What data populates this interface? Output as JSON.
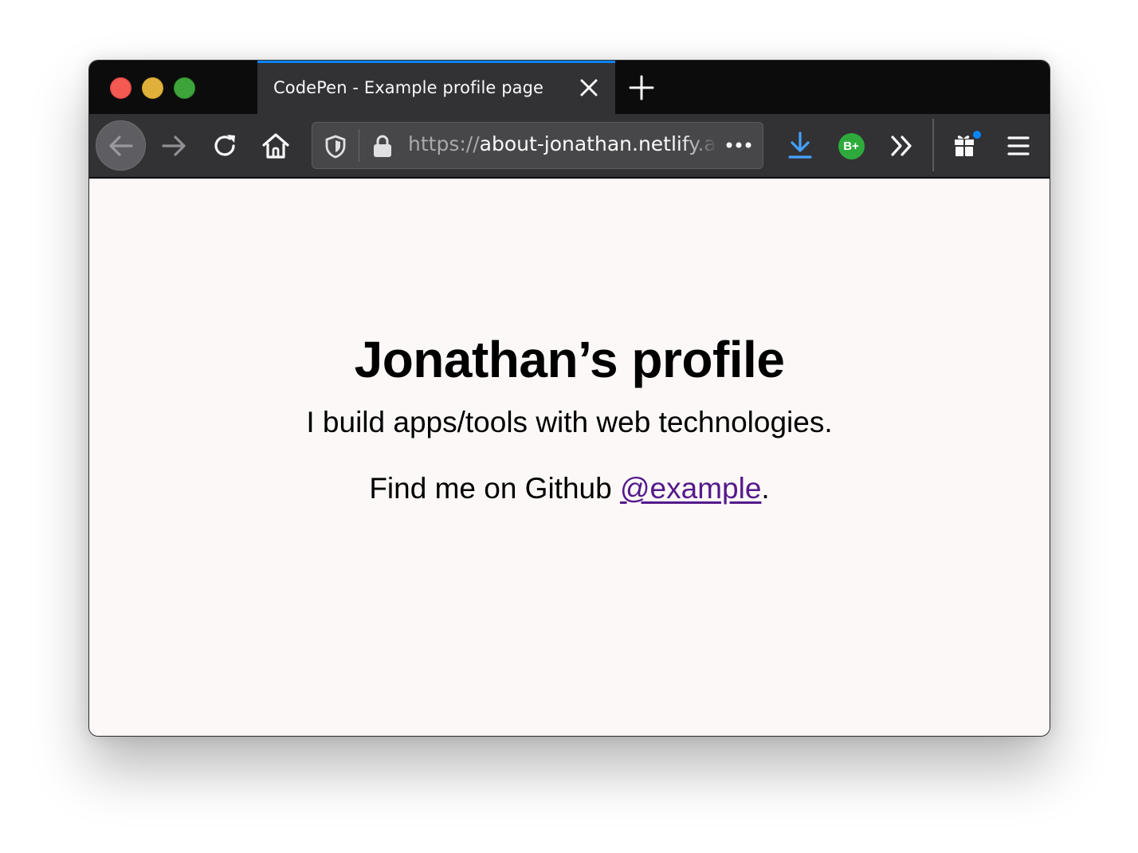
{
  "browser": {
    "tab": {
      "title": "CodePen - Example profile page"
    },
    "urlbar": {
      "scheme": "https://",
      "host": "about-jonathan.netlify.app"
    },
    "extensions": {
      "bplus_label": "B+"
    },
    "colors": {
      "accent": "#0a84ff",
      "tab_strip": "#0c0c0d",
      "toolbar": "#323234",
      "download_icon": "#45a1ff",
      "extension_badge": "#2eaa3d",
      "notification_dot": "#0a84ff"
    },
    "icons": [
      "close-icon",
      "plus-icon",
      "arrow-left-icon",
      "arrow-right-icon",
      "reload-icon",
      "home-icon",
      "shield-icon",
      "lock-icon",
      "more-dots-icon",
      "download-icon",
      "chevron-double-right-icon",
      "gift-icon",
      "hamburger-menu-icon"
    ]
  },
  "page": {
    "title": "Jonathan’s profile",
    "tagline": "I build apps/tools with web technologies.",
    "github": {
      "prefix": "Find me on Github ",
      "link_text": "@example",
      "suffix": "."
    },
    "colors": {
      "background": "#fcf8f7",
      "link": "#551a8b"
    }
  }
}
